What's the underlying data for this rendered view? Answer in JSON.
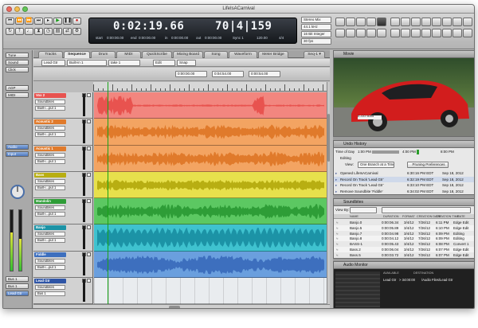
{
  "window": {
    "title": "LifeIsACarnival"
  },
  "transport": {
    "main_counter": "0:02:19.66",
    "bars_counter": "70|4|159",
    "start_label": "start",
    "start_value": "0:00:00.00",
    "end_label": "end",
    "end_value": "0:00:00.00",
    "in_label": "in",
    "in_value": "0:00:00.00",
    "out_label": "out",
    "out_value": "0:00:00.00",
    "sync_label": "Sync 1",
    "tempo_value": "120.00",
    "meter_value": "4/4",
    "format_top": "Stereo Mix",
    "rate_value": "44.1 kHz",
    "bit_value": "16 Bit Integer",
    "fps_value": "30 fps"
  },
  "left_toolbar": {
    "items": [
      "Tune",
      "Sound",
      "Click",
      "AGP",
      "MIDI",
      "Audio",
      "Input"
    ],
    "chip_label": "Lead Gtr",
    "bottom_labels": [
      "Bus 1",
      "Bus 1"
    ]
  },
  "tabs": [
    {
      "label": "Tracks"
    },
    {
      "label": "Sequence",
      "active": true
    },
    {
      "label": "Drum"
    },
    {
      "label": "MIDI"
    },
    {
      "label": "QuickScribe"
    },
    {
      "label": "Mixing Board"
    },
    {
      "label": "Song"
    },
    {
      "label": "Waveform"
    },
    {
      "label": "Meter Bridge"
    },
    {
      "label": "Seq-1 ▾"
    }
  ],
  "sequence_bar": {
    "track_selector": "Lead Gtr",
    "input_selector": "Built-in 1",
    "take_selector": "take 1",
    "edit_mode": "Edit",
    "snap": "Snap"
  },
  "sequence_bar2": {
    "start": "0:00:00.00",
    "end": "0:04:54.00",
    "loop_end": "0:00:54.00"
  },
  "tracks": [
    {
      "name": "Vox 2",
      "sound": "Soundbites",
      "input": "Built-i...put 1",
      "color": "#e8534f",
      "lane": "#f2867f"
    },
    {
      "name": "Acoustic 2",
      "sound": "Soundbites",
      "input": "Built-i...put 1",
      "color": "#e07a2b",
      "lane": "#f3a462"
    },
    {
      "name": "Acoustic 1",
      "sound": "Soundbites",
      "input": "Built-i...put 1",
      "color": "#e07a2b",
      "lane": "#f3a462"
    },
    {
      "name": "Bass",
      "sound": "Soundbites",
      "input": "Built-i...put 1",
      "color": "#b8ae12",
      "lane": "#e7e04c"
    },
    {
      "name": "Mandolin",
      "sound": "Soundbites",
      "input": "Built-i...put 1",
      "color": "#2e9d37",
      "lane": "#5cc862"
    },
    {
      "name": "Banjo",
      "sound": "Soundbites",
      "input": "Built-i...put 1",
      "color": "#1c93a6",
      "lane": "#3fc2cf"
    },
    {
      "name": "Fiddle",
      "sound": "Soundbites",
      "input": "Built-i...put 1",
      "color": "#3d6fbe",
      "lane": "#6a9fde"
    },
    {
      "name": "Lead Gtr",
      "sound": "Soundbites",
      "input": "Bus 1",
      "color": "#2f55a6",
      "lane": "#e9ecef"
    }
  ],
  "panels": {
    "movie": {
      "title": "Movie",
      "plate": "E-GO 5005"
    },
    "undo_history": {
      "title": "Undo History",
      "time_of_day_label": "Time of Day",
      "time_of_day": "1:00 PM",
      "time_mid": "4:00 PM",
      "time_end": "8:00 PM",
      "editing_label": "Editing",
      "view_label": "View:",
      "view_value": "One Branch at a Time",
      "pruning_button": "Pruning Preferences",
      "rows": [
        {
          "action": "Opened LifeIsACarnival",
          "time": "6:30:16 PM EDT",
          "date": "Sep 18, 2012"
        },
        {
          "action": "Record On Track 'Lead Gtr'",
          "time": "6:32:19 PM EDT",
          "date": "Sep 18, 2012"
        },
        {
          "action": "Record On Track 'Lead Gtr'",
          "time": "6:33:10 PM EDT",
          "date": "Sep 18, 2012"
        },
        {
          "action": "Remove Soundbite 'Fiddle'",
          "time": "6:34:02 PM EDT",
          "date": "Sep 18, 2012"
        }
      ]
    },
    "soundbites": {
      "title": "Soundbites",
      "view_label": "View By:",
      "headers": [
        "NAME",
        "DURATION",
        "FORMAT",
        "CREATION DATE",
        "CREATION TIME",
        "RATE"
      ],
      "rows": [
        {
          "name": "Banjo.0",
          "duration": "0:00:06.34",
          "format": "3/4/12",
          "date": "7/26/12",
          "time": "6:11 PM",
          "tag": "Edge Edit"
        },
        {
          "name": "Banjo.5",
          "duration": "0:00:05.89",
          "format": "3/4/12",
          "date": "7/26/12",
          "time": "6:10 PM",
          "tag": "Edge Edit"
        },
        {
          "name": "Banjo.7",
          "duration": "0:00:04.98",
          "format": "3/4/12",
          "date": "7/26/12",
          "time": "6:09 PM",
          "tag": "Editing"
        },
        {
          "name": "Banjo.8",
          "duration": "0:00:04.12",
          "format": "3/4/12",
          "date": "7/26/12",
          "time": "6:09 PM",
          "tag": "Editing"
        },
        {
          "name": "BASS-1",
          "duration": "0:00:05.43",
          "format": "3/4/12",
          "date": "7/26/12",
          "time": "6:08 PM",
          "tag": "Convert 1"
        },
        {
          "name": "Bass.2",
          "duration": "0:00:06.04",
          "format": "3/4/12",
          "date": "7/26/12",
          "time": "6:07 PM",
          "tag": "Edge Edit"
        },
        {
          "name": "Bass.5",
          "duration": "0:00:03.72",
          "format": "3/4/12",
          "date": "7/26/12",
          "time": "6:07 PM",
          "tag": "Edge Edit"
        }
      ]
    },
    "audio_monitor": {
      "title": "Audio Monitor",
      "headers": [
        "AVAILABLE",
        "DESTINATION"
      ],
      "track": "Lead Gtr",
      "available": "> 34:00:00",
      "destination": "/Audio Files/Lead Gtr"
    }
  }
}
